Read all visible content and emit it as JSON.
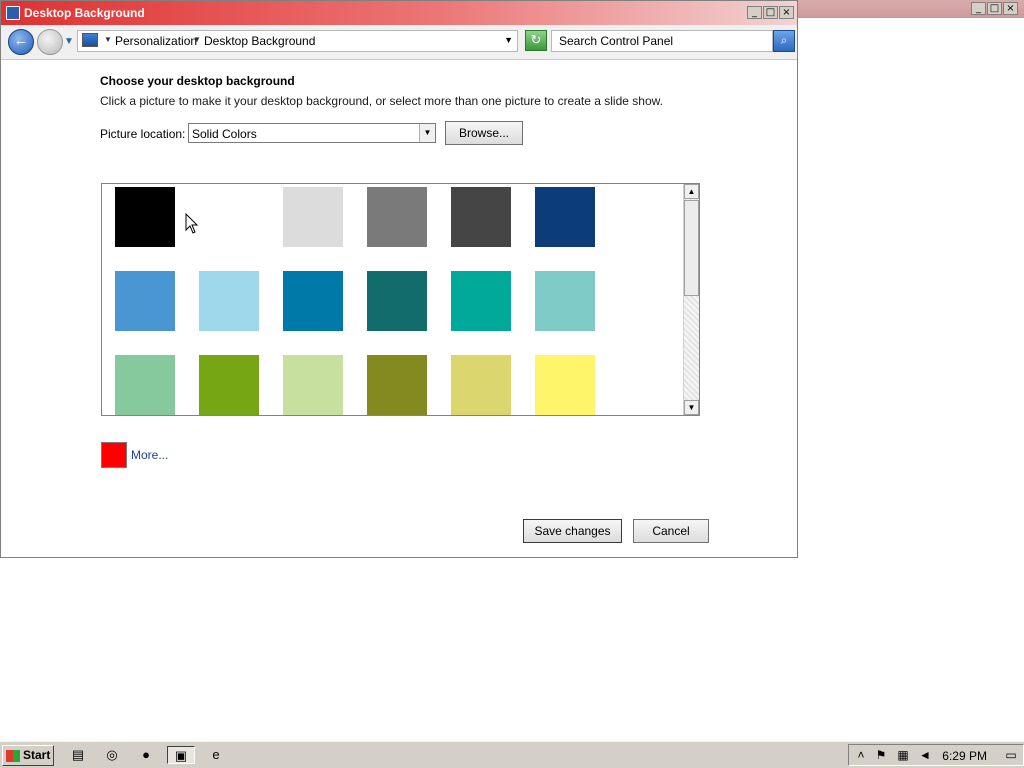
{
  "window": {
    "title": "Desktop Background"
  },
  "addressbar": {
    "crumbs": [
      "Personalization",
      "Desktop Background"
    ],
    "search_placeholder": "Search Control Panel"
  },
  "content": {
    "heading": "Choose your desktop background",
    "description": "Click a picture to make it your desktop background, or select more than one picture to create a slide show.",
    "picture_location_label": "Picture location:",
    "picture_location_value": "Solid Colors",
    "browse_label": "Browse...",
    "swatches": [
      "#000000",
      "#ffffff",
      "#dcdcdc",
      "#7a7a7a",
      "#454545",
      "#0d3c7a",
      "#4a96d2",
      "#9fd8ea",
      "#0078a8",
      "#126c6c",
      "#00a99a",
      "#7ecbc7",
      "#86c99c",
      "#77a614",
      "#c7e0a0",
      "#858a20",
      "#dbd66e",
      "#fff56b"
    ],
    "more_color": "#ff0000",
    "more_label": "More...",
    "save_label": "Save changes",
    "cancel_label": "Cancel"
  },
  "taskbar": {
    "start_label": "Start",
    "clock": "6:29 PM",
    "apps": [
      "folder-icon",
      "chrome-icon",
      "firefox-icon",
      "control-panel-icon",
      "ie-icon"
    ]
  }
}
